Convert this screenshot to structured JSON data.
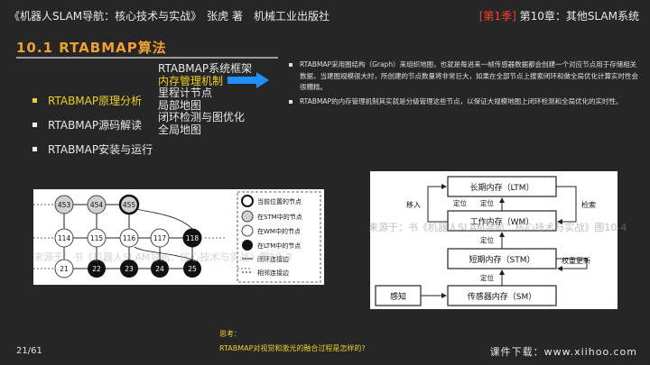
{
  "header": {
    "book_title": "《机器人SLAM导航：核心技术与实战》　张虎 著　机械工业出版社",
    "section_tag": "[第1季]",
    "chapter": "第10章：其他SLAM系统"
  },
  "slide": {
    "title": "10.1 RTABMAP算法"
  },
  "nav": {
    "items": [
      {
        "label": "RTABMAP原理分析",
        "active": true
      },
      {
        "label": "RTABMAP源码解读",
        "active": false
      },
      {
        "label": "RTABMAP安装与运行",
        "active": false
      }
    ]
  },
  "subtopics": [
    "RTABMAP系统框架",
    "内存管理机制",
    "里程计节点",
    "局部地图",
    "闭环检测与图优化",
    "全局地图"
  ],
  "highlighted_subtopic": "内存管理机制",
  "bullets": [
    "RTABMAP采用图结构（Graph）来组织地图，也就是每进来一帧传感器数据都会创建一个对应节点用于存储相关数据，当建图规模很大时，所创建的节点数量将非常巨大，如果在全部节点上搜索闭环和做全局优化计算实时性会很糟糕。",
    "RTABMAP的内存管理机制其实就是分级管理这些节点，以保证大规模地图上闭环检测和全局优化的实时性。"
  ],
  "figure_left": {
    "nodes_top": [
      "453",
      "454",
      "455"
    ],
    "nodes_mid": [
      "114",
      "115",
      "116",
      "117",
      "118"
    ],
    "nodes_bot": [
      "21",
      "22",
      "23",
      "24",
      "25"
    ],
    "legend": [
      "当前位置的节点",
      "在STM中的节点",
      "在WM中的节点",
      "在LTM中的节点",
      "闭环连接边",
      "相邻连接边"
    ],
    "watermark": "来源于：书《机器人SLAM导航：核心技术与实战》图10-3"
  },
  "figure_right": {
    "ltm": "长期内存（LTM）",
    "wm": "工作内存（WM）",
    "stm": "短期内存（STM）",
    "sm": "传感器内存（SM）",
    "perception": "感知",
    "migrate_in": "移入",
    "retrieve": "检索",
    "locate1": "定位",
    "locate2": "定位",
    "locate3": "定位",
    "locate4": "定位",
    "weight_update": "权重更新",
    "watermark": "来源于：书《机器人SLAM导航：核心技术与实战》图10-4"
  },
  "think": {
    "label": "思考：",
    "question": "RTABMAP对视觉和激光的融合过程是怎样的?"
  },
  "footer": {
    "page": "21/61",
    "download": "课件下载：www.xiihoo.com"
  }
}
